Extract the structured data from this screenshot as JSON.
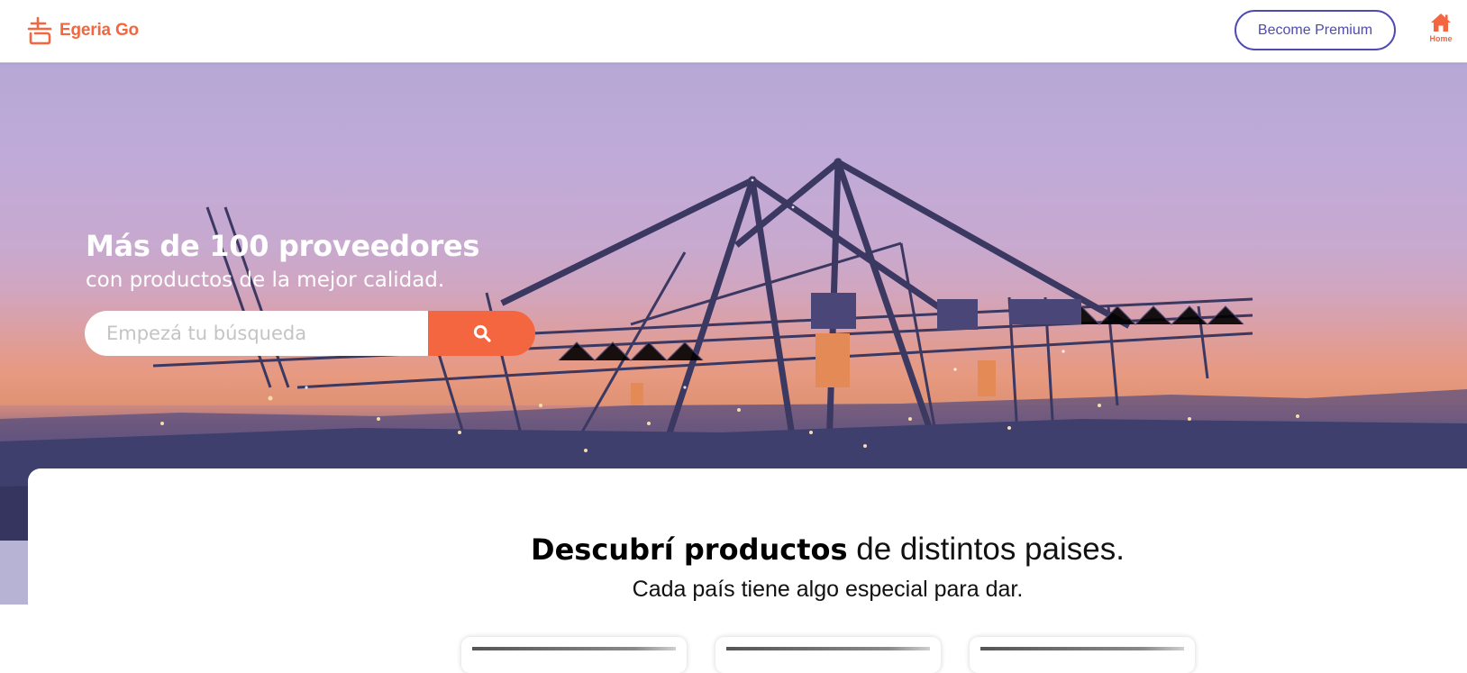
{
  "header": {
    "brand_name": "Egeria Go",
    "premium_button": "Become Premium",
    "home_label": "Home"
  },
  "hero": {
    "title": "Más de 100 proveedores",
    "subtitle": "con productos de la mejor calidad.",
    "search": {
      "placeholder": "Empezá tu búsqueda",
      "value": ""
    }
  },
  "discover": {
    "heading_bold": "Descubrí productos",
    "heading_light": " de distintos paises.",
    "subheading": "Cada país tiene algo especial para dar."
  },
  "colors": {
    "accent": "#f4663f",
    "premium": "#4f4bb0",
    "hero_sky_top": "#b6a8d6",
    "hero_sky_bottom": "#3d3f6e"
  },
  "icons": {
    "logo": "egeria-logo-icon",
    "home": "home-icon",
    "search": "search-icon"
  }
}
